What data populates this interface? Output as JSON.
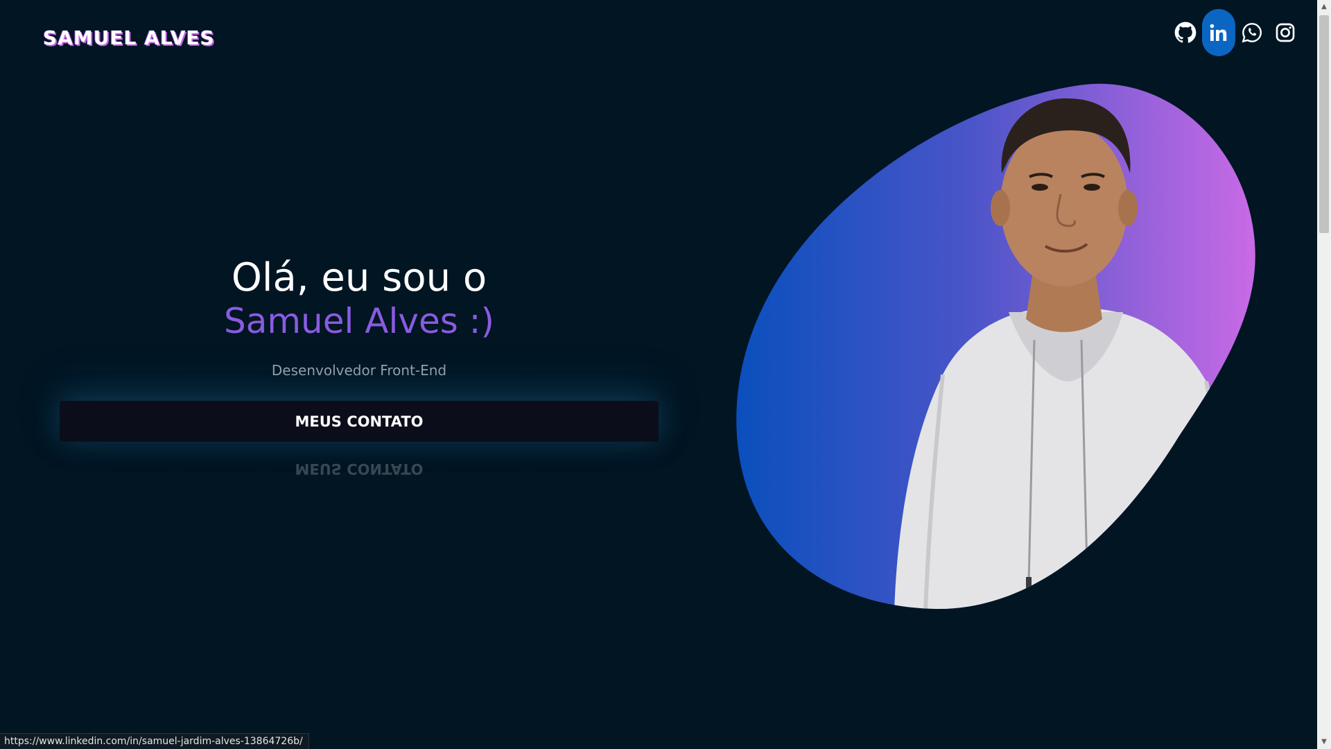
{
  "brand": "SAMUEL ALVES",
  "social": [
    {
      "name": "github-icon",
      "label": "GitHub"
    },
    {
      "name": "linkedin-icon",
      "label": "LinkedIn",
      "active": true
    },
    {
      "name": "whatsapp-icon",
      "label": "WhatsApp"
    },
    {
      "name": "instagram-icon",
      "label": "Instagram"
    }
  ],
  "hero": {
    "greeting": "Olá, eu sou o",
    "name": "Samuel Alves :)",
    "role": "Desenvolvedor Front-End",
    "cta": "MEUS CONTATO"
  },
  "status_url": "https://www.linkedin.com/in/samuel-jardim-alves-13864726b/",
  "colors": {
    "background": "#011523",
    "accent": "#8a5be0",
    "linkedin": "#0a66c2",
    "gradient_start": "#0a4fbd",
    "gradient_end": "#c76be6"
  }
}
